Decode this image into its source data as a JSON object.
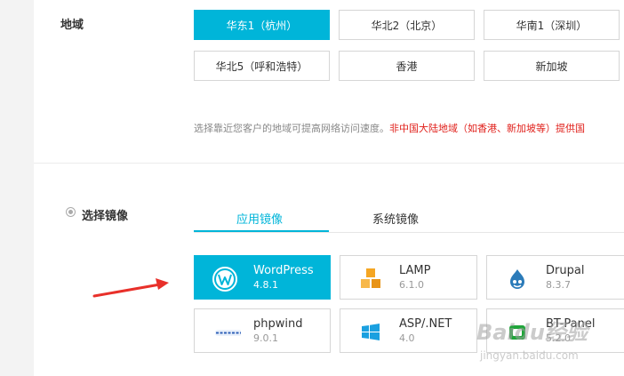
{
  "region": {
    "label": "地域",
    "options": [
      {
        "label": "华东1（杭州）",
        "selected": true
      },
      {
        "label": "华北2（北京）",
        "selected": false
      },
      {
        "label": "华南1（深圳）",
        "selected": false
      },
      {
        "label": "华北5（呼和浩特）",
        "selected": false
      },
      {
        "label": "香港",
        "selected": false
      },
      {
        "label": "新加坡",
        "selected": false
      }
    ],
    "note": "选择靠近您客户的地域可提高网络访问速度。",
    "note_highlight": "非中国大陆地域（如香港、新加坡等）提供国"
  },
  "image": {
    "label": "选择镜像",
    "tabs": [
      {
        "label": "应用镜像",
        "active": true
      },
      {
        "label": "系统镜像",
        "active": false
      }
    ],
    "items": [
      {
        "name": "WordPress",
        "version": "4.8.1",
        "icon": "wordpress-icon",
        "selected": true
      },
      {
        "name": "LAMP",
        "version": "6.1.0",
        "icon": "lamp-cubes-icon",
        "selected": false
      },
      {
        "name": "Drupal",
        "version": "8.3.7",
        "icon": "drupal-drop-icon",
        "selected": false
      },
      {
        "name": "phpwind",
        "version": "9.0.1",
        "icon": "phpwind-logo-icon",
        "selected": false
      },
      {
        "name": "ASP/.NET",
        "version": "4.0",
        "icon": "windows-logo-icon",
        "selected": false
      },
      {
        "name": "BT-Panel",
        "version": "5.2.0",
        "icon": "bt-panel-icon",
        "selected": false
      }
    ]
  },
  "watermark": {
    "text": "Baidu经验",
    "sub": "jingyan.baidu.com"
  },
  "colors": {
    "accent": "#00b5d9",
    "arrow": "#e8302a",
    "warning": "#e0201b"
  }
}
